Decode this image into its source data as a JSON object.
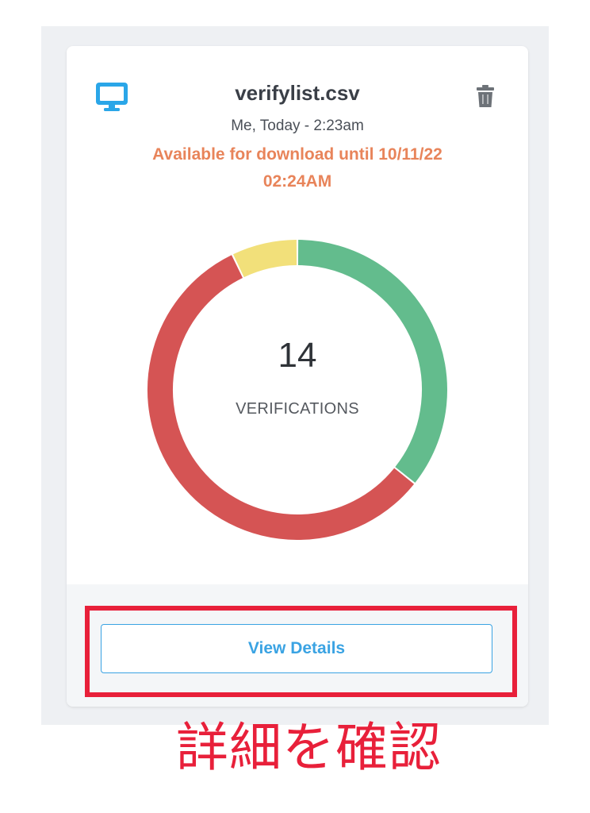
{
  "file": {
    "name": "verifylist.csv",
    "meta": "Me, Today - 2:23am",
    "availability": "Available for download until 10/11/22 02:24AM",
    "source_icon": "desktop-monitor-icon",
    "delete_icon": "trash-icon"
  },
  "summary": {
    "count": "14",
    "label": "VERIFICATIONS"
  },
  "chart_data": {
    "type": "pie",
    "style": "donut",
    "total": 14,
    "segments": [
      {
        "value": 5,
        "color": "#63bc8d"
      },
      {
        "value": 8,
        "color": "#d55454"
      },
      {
        "value": 1,
        "color": "#f2e07a"
      }
    ]
  },
  "actions": {
    "view_details_label": "View Details"
  },
  "annotation": {
    "text": "詳細を確認"
  },
  "colors": {
    "accent": "#3aa3e3",
    "warning_text": "#e8845a",
    "annotation_red": "#e8203a"
  }
}
